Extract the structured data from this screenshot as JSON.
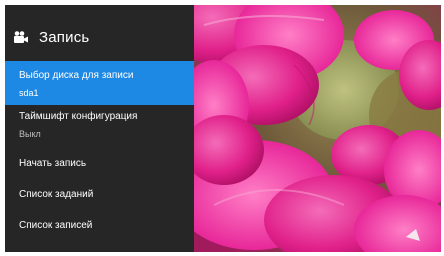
{
  "header": {
    "icon": "video-camera-icon",
    "title": "Запись"
  },
  "menu": {
    "items": [
      {
        "label": "Выбор диска для записи",
        "value": "sda1",
        "selected": true
      },
      {
        "label": "Таймшифт конфигурация",
        "value": "Выкл"
      },
      {
        "label": "Начать запись"
      },
      {
        "label": "Список заданий"
      },
      {
        "label": "Список записей"
      }
    ]
  },
  "colors": {
    "panel_bg": "#262626",
    "accent": "#1e88e5",
    "secondary_text": "#bdbdbd",
    "flower_pink": "#e0208a"
  }
}
